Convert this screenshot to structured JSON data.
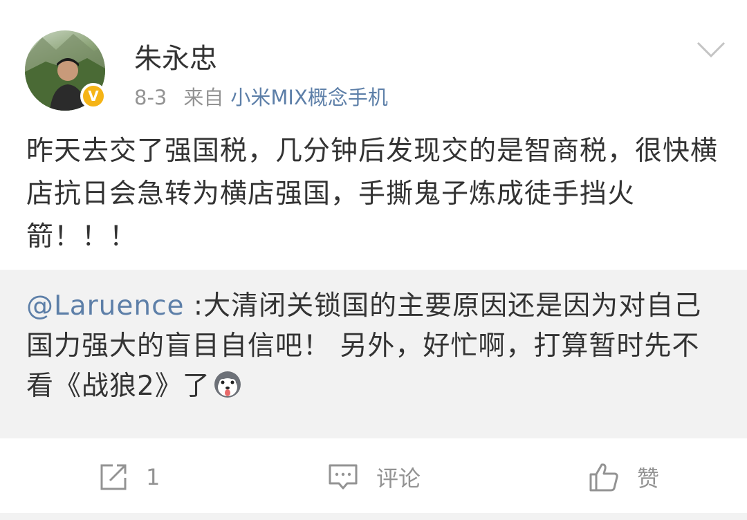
{
  "post": {
    "author": "朱永忠",
    "time": "8-3",
    "source_prefix": "来自",
    "source_name": "小米MIX概念手机",
    "text": "昨天去交了强国税，几分钟后发现交的是智商税，很快横店抗日会急转为横店强国，手撕鬼子炼成徒手挡火箭！！！"
  },
  "repost": {
    "mention": "@Laruence",
    "text": " :大清闭关锁国的主要原因还是因为对自己国力强大的盲目自信吧！ 另外，好忙啊，打算暂时先不看《战狼2》了",
    "emoji": "husky-emoji"
  },
  "actions": {
    "share_count": "1",
    "comment_label": "评论",
    "like_label": "赞"
  },
  "colors": {
    "link": "#5d7fa8",
    "badge": "#f5b416",
    "muted": "#939393",
    "repost_bg": "#f2f2f2"
  }
}
